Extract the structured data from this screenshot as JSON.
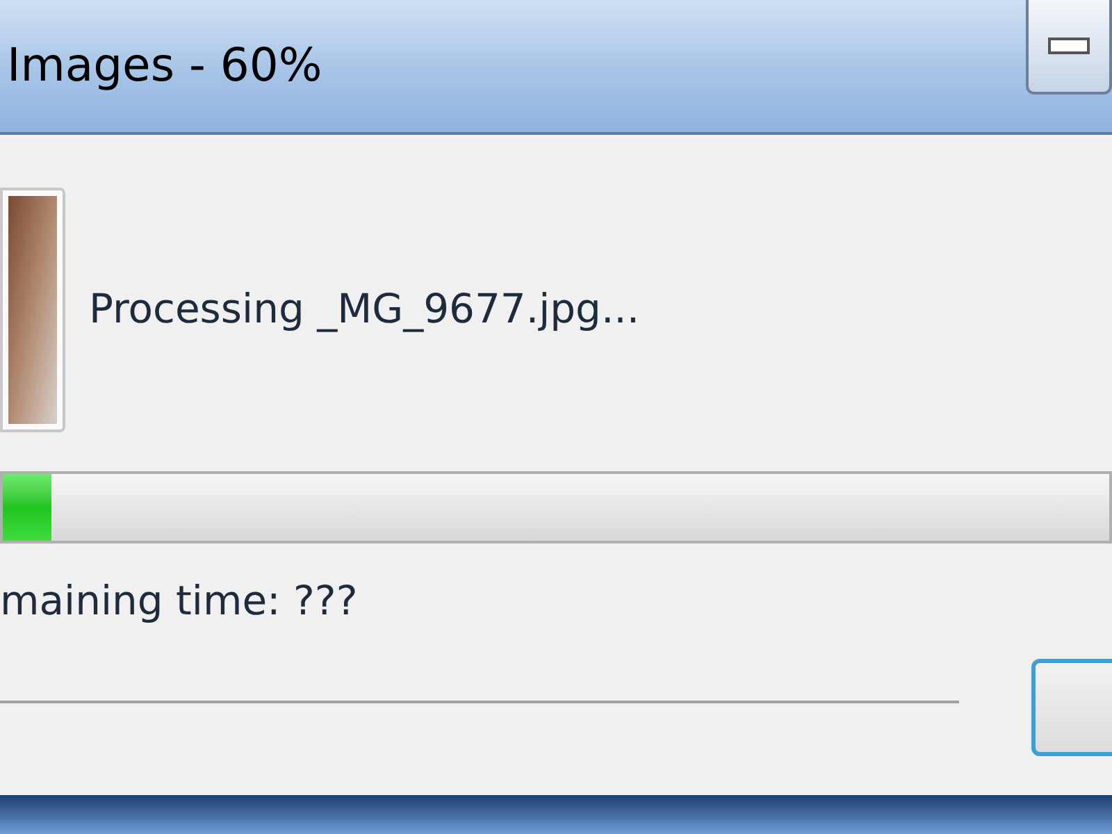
{
  "window": {
    "title": "Images - 60%"
  },
  "status": {
    "text": "Processing _MG_9677.jpg..."
  },
  "progress": {
    "level": 0.044
  },
  "remaining": {
    "text": "maining time: ???"
  }
}
